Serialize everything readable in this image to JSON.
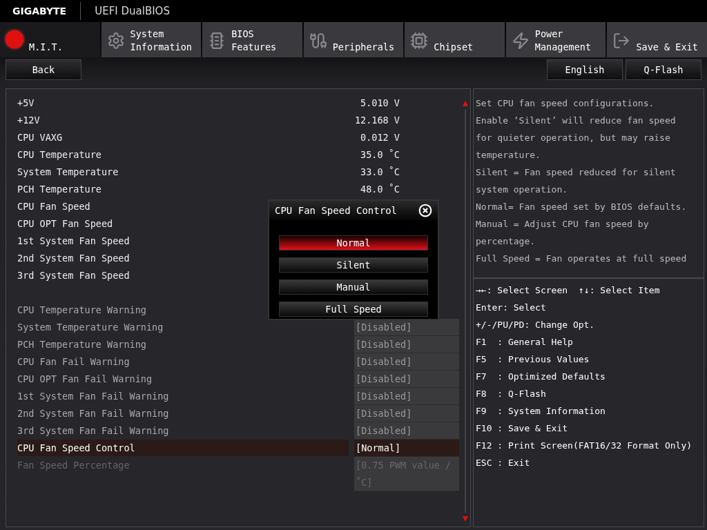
{
  "header": {
    "brand": "GIGABYTE",
    "title": "UEFI DualBIOS"
  },
  "tabs": [
    {
      "label": "M.I.T.",
      "kind": "mit",
      "selected": true
    },
    {
      "label": "System\nInformation",
      "kind": "gear",
      "selected": false
    },
    {
      "label": "BIOS\nFeatures",
      "kind": "bios",
      "selected": false
    },
    {
      "label": "Peripherals",
      "kind": "periph",
      "selected": false
    },
    {
      "label": "Chipset",
      "kind": "chip",
      "selected": false
    },
    {
      "label": "Power\nManagement",
      "kind": "power",
      "selected": false
    },
    {
      "label": "Save & Exit",
      "kind": "exit",
      "selected": false
    }
  ],
  "toolbar": {
    "back": "Back",
    "buttons": [
      "English",
      "Q-Flash"
    ]
  },
  "readings": [
    {
      "name": "+5V",
      "value": "5.010 V"
    },
    {
      "name": "+12V",
      "value": "12.168 V"
    },
    {
      "name": "CPU VAXG",
      "value": "0.012 V"
    },
    {
      "name": "CPU Temperature",
      "value": "35.0 ˚C"
    },
    {
      "name": "System Temperature",
      "value": "33.0 ˚C"
    },
    {
      "name": "PCH Temperature",
      "value": "48.0 ˚C"
    },
    {
      "name": "CPU Fan Speed"
    },
    {
      "name": "CPU OPT Fan Speed"
    },
    {
      "name": "1st System Fan Speed"
    },
    {
      "name": "2nd System Fan Speed"
    },
    {
      "name": "3rd System Fan Speed"
    }
  ],
  "settings": [
    {
      "name": "CPU Temperature Warning",
      "selected": false,
      "disabled": false
    },
    {
      "name": "System Temperature Warning",
      "value": "[Disabled]",
      "selected": false,
      "disabled": false
    },
    {
      "name": "PCH Temperature Warning",
      "value": "[Disabled]",
      "selected": false,
      "disabled": false
    },
    {
      "name": "CPU Fan Fail Warning",
      "value": "[Disabled]",
      "selected": false,
      "disabled": false
    },
    {
      "name": "CPU OPT Fan Fail Warning",
      "value": "[Disabled]",
      "selected": false,
      "disabled": false
    },
    {
      "name": "1st System Fan Fail Warning",
      "value": "[Disabled]",
      "selected": false,
      "disabled": false
    },
    {
      "name": "2nd System Fan Fail Warning",
      "value": "[Disabled]",
      "selected": false,
      "disabled": false
    },
    {
      "name": "3rd System Fan Fail Warning",
      "value": "[Disabled]",
      "selected": false,
      "disabled": false
    },
    {
      "name": "CPU Fan Speed Control",
      "value": "[Normal]",
      "selected": true,
      "disabled": false
    },
    {
      "name": "Fan Speed Percentage",
      "value": "[0.75 PWM value /˚C]",
      "selected": false,
      "disabled": true
    }
  ],
  "help": [
    "Set CPU fan speed configurations.",
    "Enable ‘Silent’ will reduce fan speed for quieter operation, but may raise temperature.",
    "Silent = Fan speed reduced for silent system operation.",
    "Normal= Fan speed set by BIOS defaults.",
    "Manual = Adjust CPU fan speed by percentage.",
    "Full Speed = Fan operates at full speed"
  ],
  "keys": [
    [
      "→←: Select Screen",
      "↑↓: Select Item"
    ],
    [
      "Enter: Select"
    ],
    [
      "+/-/PU/PD: Change Opt."
    ],
    [
      "F1  : General Help"
    ],
    [
      "F5  : Previous Values"
    ],
    [
      "F7  : Optimized Defaults"
    ],
    [
      "F8  : Q-Flash"
    ],
    [
      "F9  : System Information"
    ],
    [
      "F10 : Save & Exit"
    ],
    [
      "F12 : Print Screen(FAT16/32 Format Only)"
    ],
    [
      "ESC : Exit"
    ]
  ],
  "popup": {
    "title": "CPU Fan Speed Control",
    "options": [
      {
        "label": "Normal",
        "selected": true
      },
      {
        "label": "Silent",
        "selected": false
      },
      {
        "label": "Manual",
        "selected": false
      },
      {
        "label": "Full Speed",
        "selected": false
      }
    ]
  }
}
